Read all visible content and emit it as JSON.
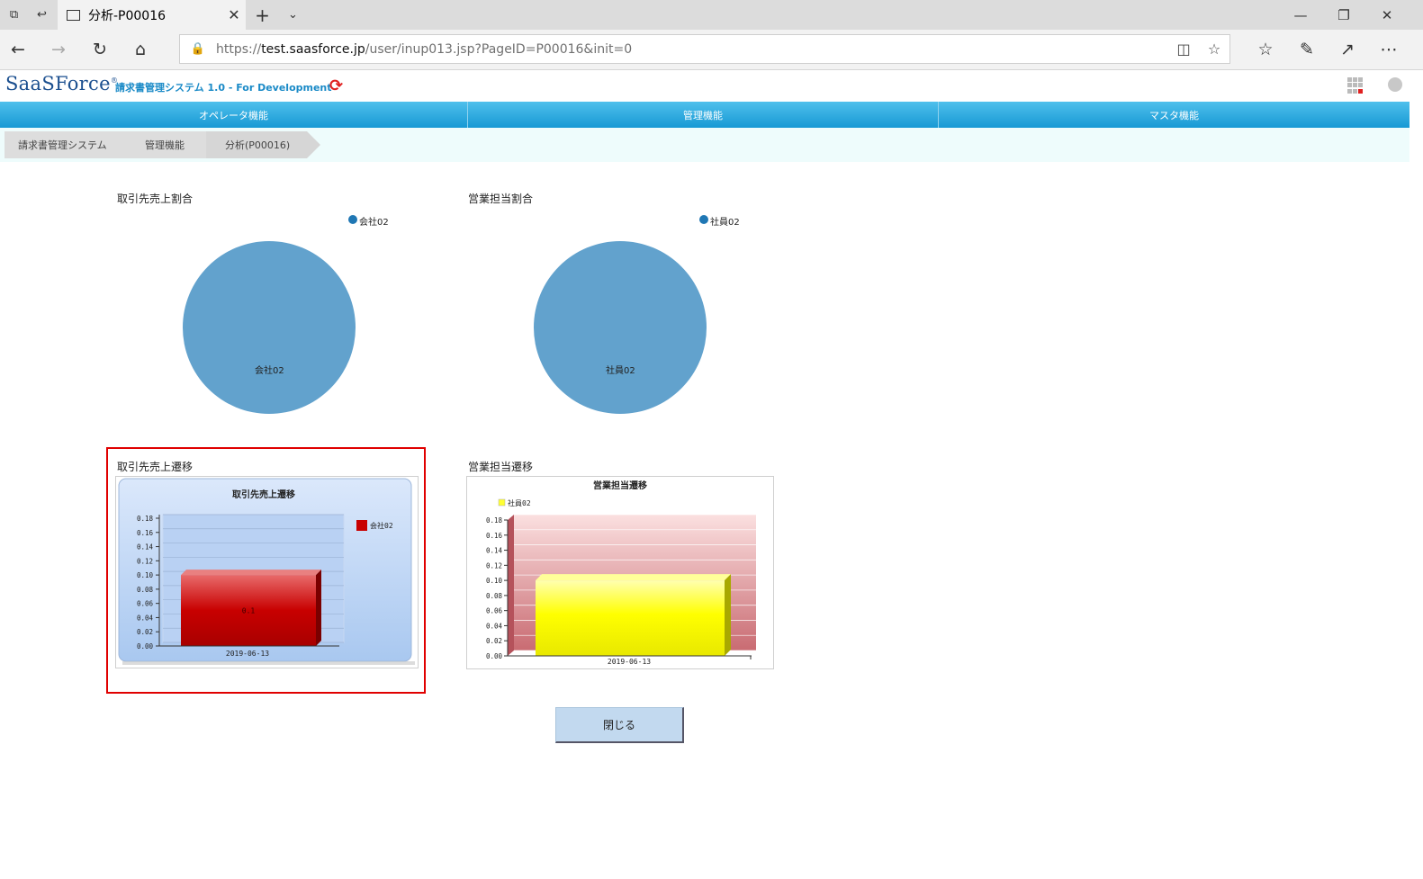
{
  "browser": {
    "tab_title": "分析-P00016",
    "url_prefix": "https://",
    "url_host": "test.saasforce.jp",
    "url_path": "/user/inup013.jsp?PageID=P00016&init=0"
  },
  "app": {
    "logo": "SaaSForce",
    "logo_mark": "®",
    "system_name": "請求書管理システム 1.0 - For Development"
  },
  "menu": [
    "オペレータ機能",
    "管理機能",
    "マスタ機能"
  ],
  "breadcrumb": [
    "請求書管理システム",
    "管理機能",
    "分析(P00016)"
  ],
  "sections": {
    "client_share_title": "取引先売上割合",
    "staff_share_title": "営業担当割合",
    "client_trend_title": "取引先売上遷移",
    "staff_trend_title": "営業担当遷移"
  },
  "close_button": "閉じる",
  "chart_data": [
    {
      "type": "pie",
      "labels": [
        "会社02"
      ],
      "values": [
        1
      ],
      "colors": [
        "#62a2cd"
      ],
      "legend": "top-right"
    },
    {
      "type": "pie",
      "labels": [
        "社員02"
      ],
      "values": [
        1
      ],
      "colors": [
        "#62a2cd"
      ],
      "legend": "top-right"
    },
    {
      "type": "bar",
      "title": "取引先売上遷移",
      "categories": [
        "2019-06-13"
      ],
      "series": [
        {
          "name": "会社02",
          "values": [
            0.1
          ],
          "color": "#c80000"
        }
      ],
      "data_labels": [
        "0.1"
      ],
      "y_ticks": [
        "0.00",
        "0.02",
        "0.04",
        "0.06",
        "0.08",
        "0.10",
        "0.12",
        "0.14",
        "0.16",
        "0.18"
      ],
      "ylim": [
        0,
        0.18
      ],
      "grid": true,
      "legend": "right"
    },
    {
      "type": "bar",
      "title": "営業担当遷移",
      "categories": [
        "2019-06-13"
      ],
      "series": [
        {
          "name": "社員02",
          "values": [
            0.1
          ],
          "color": "#ffff00"
        }
      ],
      "y_ticks": [
        "0.00",
        "0.02",
        "0.04",
        "0.06",
        "0.08",
        "0.10",
        "0.12",
        "0.14",
        "0.16",
        "0.18"
      ],
      "ylim": [
        0,
        0.18
      ],
      "grid": true,
      "legend": "top-left"
    }
  ]
}
